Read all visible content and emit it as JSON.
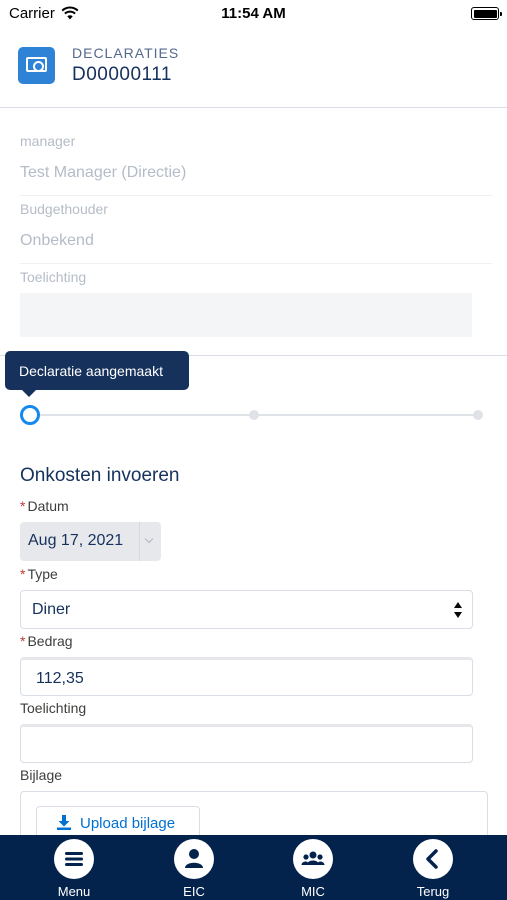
{
  "status_bar": {
    "carrier": "Carrier",
    "time": "11:54 AM"
  },
  "header": {
    "object_type": "DECLARATIES",
    "record_name": "D00000111",
    "icon": "money-icon"
  },
  "details": {
    "manager_label": "manager",
    "manager_value": "Test Manager (Directie)",
    "budgethouder_label": "Budgethouder",
    "budgethouder_value": "Onbekend",
    "toelichting_label": "Toelichting",
    "toelichting_value": ""
  },
  "path": {
    "tooltip": "Declaratie aangemaakt",
    "steps_total": 3,
    "current_step": 1
  },
  "form": {
    "section_title": "Onkosten invoeren",
    "required_marker": "*",
    "datum_label": "Datum",
    "datum_value": "Aug 17, 2021",
    "type_label": "Type",
    "type_value": "Diner",
    "bedrag_label": "Bedrag",
    "bedrag_value": "112,35",
    "toelichting_label": "Toelichting",
    "toelichting_value": "",
    "bijlage_label": "Bijlage",
    "upload_label": "Upload bijlage"
  },
  "bottom_nav": [
    {
      "label": "Menu",
      "icon": "menu-icon"
    },
    {
      "label": "EIC",
      "icon": "user-icon"
    },
    {
      "label": "MIC",
      "icon": "group-icon"
    },
    {
      "label": "Terug",
      "icon": "back-icon"
    }
  ],
  "colors": {
    "brand_blue": "#2f83d6",
    "nav_background": "#03234d",
    "progress_active": "#1589ee",
    "required_red": "#c23934",
    "link_blue": "#0070d2"
  }
}
